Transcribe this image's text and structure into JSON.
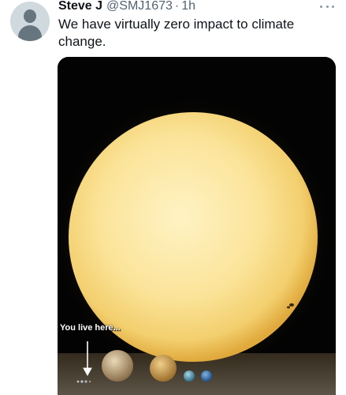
{
  "author": {
    "name": "Steve J",
    "handle": "@SMJ1673",
    "separator": "·",
    "time": "1h",
    "avatar_icon": "default-profile-icon"
  },
  "tweet": {
    "text": "We have virtually zero impact to climate change."
  },
  "menu": {
    "icon": "more-horizontal-icon"
  },
  "media": {
    "caption": "You live here..."
  }
}
